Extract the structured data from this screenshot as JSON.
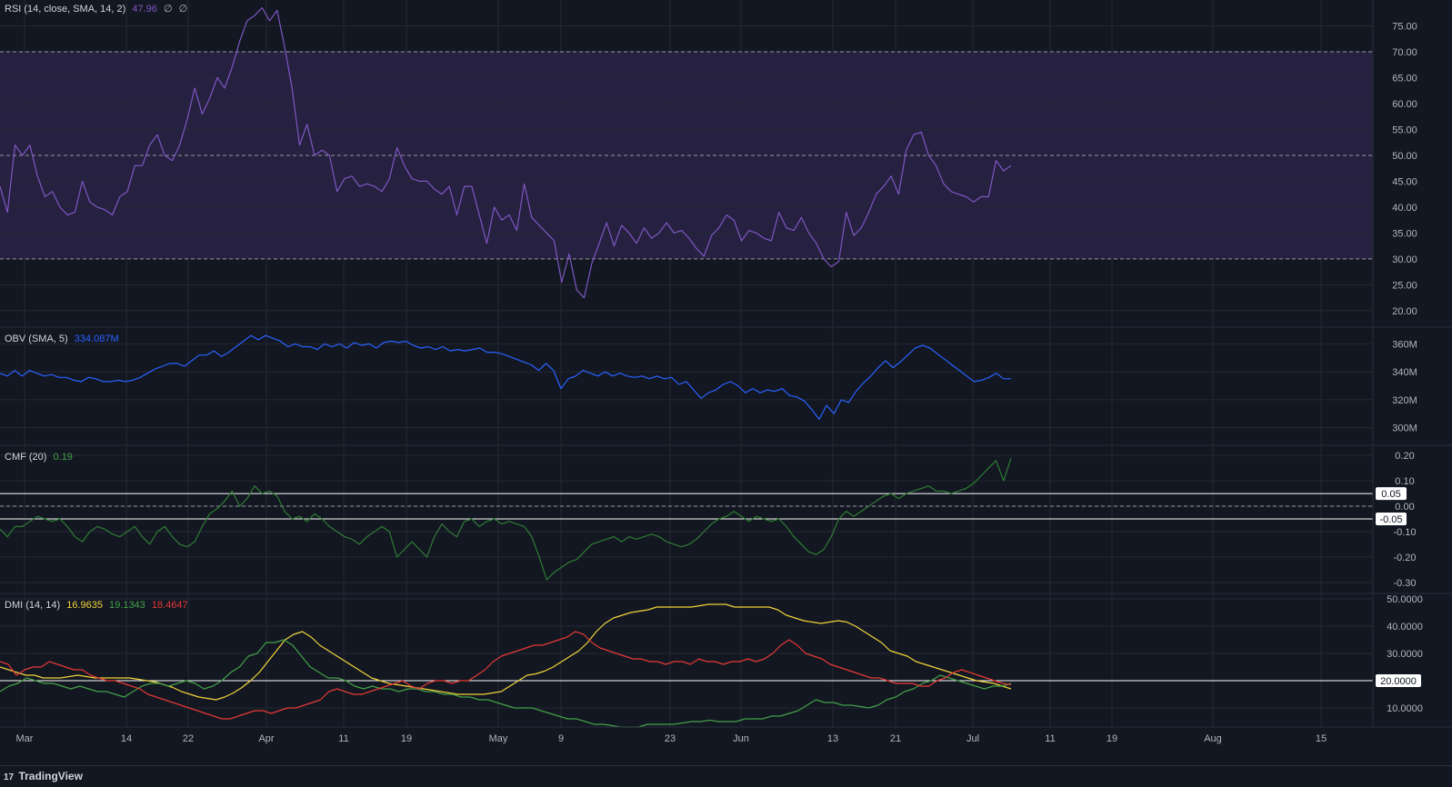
{
  "colors": {
    "background": "#131722",
    "grid": "#242833",
    "axis_text": "#b2b5be",
    "rsi": "#7e57c2",
    "rsi_band": "#2a2247",
    "obv": "#2962ff",
    "cmf": "#2e7d32",
    "dmi_adx": "#f0d43a",
    "dmi_plus": "#43a047",
    "dmi_minus": "#e53935",
    "ref_line": "#ffffff"
  },
  "legends": {
    "rsi": {
      "label": "RSI (14, close, SMA, 14, 2)",
      "value": "47.96",
      "extra1": "∅",
      "extra2": "∅"
    },
    "obv": {
      "label": "OBV (SMA, 5)",
      "value": "334.087M"
    },
    "cmf": {
      "label": "CMF (20)",
      "value": "0.19"
    },
    "dmi": {
      "label": "DMI (14, 14)",
      "adx": "16.9635",
      "plus": "19.1343",
      "minus": "18.4647"
    }
  },
  "x_axis": {
    "ticks": [
      "Mar",
      "14",
      "22",
      "Apr",
      "11",
      "19",
      "May",
      "9",
      "23",
      "Jun",
      "13",
      "21",
      "Jul",
      "11",
      "19",
      "Aug",
      "15"
    ]
  },
  "footer": {
    "brand": "TradingView",
    "logo_mark": "17"
  },
  "chart_data": [
    {
      "type": "line",
      "name": "RSI (14, close, SMA, 14, 2)",
      "ylim": [
        17,
        80
      ],
      "y_ticks": [
        "75.00",
        "70.00",
        "65.00",
        "60.00",
        "55.00",
        "50.00",
        "45.00",
        "40.00",
        "35.00",
        "30.00",
        "25.00",
        "20.00"
      ],
      "reference_lines": [
        70,
        50,
        30
      ],
      "band": [
        30,
        70
      ],
      "values": [
        44,
        39,
        52,
        50,
        52,
        46,
        42,
        43,
        40,
        38.5,
        39,
        45,
        41,
        40,
        39.5,
        38.5,
        42,
        43,
        48,
        48,
        52,
        54,
        50,
        49,
        52,
        57,
        63,
        58,
        61,
        65,
        63,
        67,
        72,
        76,
        77,
        78.5,
        76,
        78,
        71,
        63,
        52,
        56,
        50,
        51,
        50,
        43,
        45.5,
        46,
        44,
        44.5,
        44,
        43,
        45.5,
        51.5,
        48,
        45.5,
        45,
        45,
        43.5,
        42.5,
        44,
        38.5,
        44,
        44,
        38.5,
        33,
        40,
        37.5,
        38.5,
        35.5,
        44.5,
        38,
        36.5,
        35,
        33.5,
        25.5,
        31,
        24,
        22.5,
        29,
        33,
        37,
        32.5,
        36.5,
        35,
        33,
        36,
        34,
        35,
        37,
        35,
        35.5,
        34,
        32,
        30.5,
        34.5,
        36,
        38.5,
        37.5,
        33.5,
        35.5,
        35,
        34,
        33.5,
        39,
        36,
        35.5,
        38,
        35,
        33,
        30,
        28.5,
        29.5,
        39,
        34.5,
        36,
        39,
        42.5,
        44,
        46,
        42.5,
        51,
        54,
        54.5,
        50,
        48,
        44.5,
        43,
        42.5,
        42,
        41,
        42,
        42,
        49,
        47,
        48
      ]
    },
    {
      "type": "line",
      "name": "OBV (SMA, 5)",
      "ylim": [
        288,
        372
      ],
      "y_ticks": [
        "360M",
        "340M",
        "320M",
        "300M"
      ],
      "values": [
        339,
        337,
        341,
        337,
        341,
        339,
        337,
        338,
        336,
        336,
        334,
        333,
        336,
        335,
        333,
        333,
        334,
        333,
        334,
        336,
        339,
        342,
        344,
        346,
        346,
        344,
        348,
        352,
        352,
        355,
        351,
        354,
        358,
        362,
        366,
        363,
        366,
        364,
        362,
        358,
        360,
        358,
        358,
        356,
        360,
        358,
        360,
        357,
        361,
        359,
        360,
        357,
        361,
        362,
        361,
        362,
        359,
        357,
        358,
        356,
        358,
        355,
        356,
        355,
        356,
        357,
        354,
        354,
        353,
        351,
        349,
        347,
        345,
        341,
        346,
        341,
        328,
        335,
        337,
        341,
        339,
        337,
        340,
        337,
        339,
        337,
        336,
        337,
        335,
        337,
        335,
        336,
        331,
        333,
        327,
        321,
        325,
        327,
        331,
        333,
        330,
        325,
        328,
        325,
        327,
        326,
        328,
        323,
        322,
        319,
        313,
        306,
        316,
        310,
        320,
        318,
        326,
        332,
        337,
        343,
        348,
        343,
        347,
        352,
        357,
        359,
        357,
        353,
        349,
        345,
        341,
        337,
        333,
        334,
        336,
        339,
        335,
        335
      ]
    },
    {
      "type": "line",
      "name": "CMF (20)",
      "ylim": [
        -0.34,
        0.24
      ],
      "y_ticks": [
        "0.20",
        "0.10",
        "0.00",
        "-0.10",
        "-0.20",
        "-0.30"
      ],
      "labeled_lines": [
        {
          "value": 0.05,
          "label": "0.05"
        },
        {
          "value": -0.05,
          "label": "-0.05"
        }
      ],
      "dashed_line": 0,
      "values": [
        -0.09,
        -0.12,
        -0.08,
        -0.08,
        -0.06,
        -0.04,
        -0.05,
        -0.06,
        -0.05,
        -0.08,
        -0.12,
        -0.14,
        -0.1,
        -0.08,
        -0.09,
        -0.11,
        -0.12,
        -0.1,
        -0.08,
        -0.12,
        -0.15,
        -0.1,
        -0.08,
        -0.12,
        -0.15,
        -0.16,
        -0.14,
        -0.08,
        -0.03,
        -0.01,
        0.02,
        0.06,
        0.0,
        0.03,
        0.08,
        0.05,
        0.06,
        0.04,
        -0.02,
        -0.05,
        -0.04,
        -0.06,
        -0.03,
        -0.05,
        -0.08,
        -0.1,
        -0.12,
        -0.13,
        -0.15,
        -0.12,
        -0.1,
        -0.08,
        -0.1,
        -0.2,
        -0.17,
        -0.14,
        -0.17,
        -0.2,
        -0.12,
        -0.07,
        -0.1,
        -0.12,
        -0.06,
        -0.05,
        -0.08,
        -0.06,
        -0.05,
        -0.07,
        -0.06,
        -0.07,
        -0.08,
        -0.12,
        -0.2,
        -0.29,
        -0.26,
        -0.24,
        -0.22,
        -0.21,
        -0.18,
        -0.15,
        -0.14,
        -0.13,
        -0.12,
        -0.14,
        -0.12,
        -0.13,
        -0.12,
        -0.11,
        -0.12,
        -0.14,
        -0.15,
        -0.16,
        -0.15,
        -0.13,
        -0.1,
        -0.07,
        -0.05,
        -0.04,
        -0.02,
        -0.04,
        -0.06,
        -0.04,
        -0.05,
        -0.06,
        -0.05,
        -0.08,
        -0.12,
        -0.15,
        -0.18,
        -0.19,
        -0.17,
        -0.12,
        -0.05,
        -0.02,
        -0.04,
        -0.02,
        0.0,
        0.02,
        0.04,
        0.05,
        0.03,
        0.05,
        0.06,
        0.07,
        0.08,
        0.06,
        0.06,
        0.05,
        0.06,
        0.07,
        0.09,
        0.12,
        0.15,
        0.18,
        0.1,
        0.19
      ]
    },
    {
      "type": "line",
      "name": "DMI (14, 14)",
      "ylim": [
        3,
        52
      ],
      "y_ticks": [
        "50.0000",
        "40.0000",
        "30.0000",
        "10.0000"
      ],
      "labeled_lines": [
        {
          "value": 20,
          "label": "20.0000"
        }
      ],
      "x_ticks": [
        "Mar",
        "14",
        "22",
        "Apr",
        "11",
        "19",
        "May",
        "9",
        "23",
        "Jun",
        "13",
        "21",
        "Jul",
        "11",
        "19",
        "Aug",
        "15"
      ],
      "series": [
        {
          "name": "ADX",
          "values": [
            25,
            24,
            23,
            22,
            22,
            21,
            21,
            21,
            21.5,
            22,
            21.5,
            21,
            21,
            21,
            21,
            21,
            20.5,
            20,
            19.5,
            18.5,
            17.5,
            16,
            15,
            14,
            13.5,
            13,
            14,
            15.5,
            17.5,
            20,
            23,
            27,
            31,
            35,
            37,
            38,
            36,
            33,
            31,
            29,
            27,
            25,
            23,
            21,
            20,
            19,
            18.5,
            18,
            17.5,
            17,
            16.5,
            16,
            15.5,
            15,
            15,
            15,
            15,
            15.5,
            16,
            18,
            20,
            22,
            22.5,
            23.5,
            25,
            27,
            29,
            31,
            34,
            38,
            41,
            43,
            44,
            45,
            45.5,
            46,
            47,
            47,
            47,
            47,
            47,
            47.5,
            48,
            48,
            48,
            47,
            47,
            47,
            47,
            47,
            46,
            44,
            43,
            42,
            41.5,
            41,
            41.5,
            42,
            41.5,
            40,
            38,
            36,
            34,
            31,
            30,
            29,
            27,
            26,
            25,
            24,
            23,
            22,
            21,
            20,
            19.5,
            19,
            18,
            17
          ]
        },
        {
          "name": "+DI",
          "values": [
            16,
            18,
            19,
            21,
            20,
            19,
            19,
            18,
            17,
            18,
            17,
            16,
            16,
            15,
            14,
            16,
            18,
            19,
            19,
            18,
            19,
            20,
            19,
            17,
            18,
            20,
            23,
            25,
            29,
            30,
            34,
            34,
            35,
            33,
            29,
            25,
            23,
            21,
            21,
            20,
            18,
            17,
            18,
            17,
            17,
            16,
            17,
            17,
            16,
            16,
            15,
            15,
            14,
            14,
            13,
            13,
            12,
            11,
            10,
            10,
            10,
            9,
            8,
            7,
            6,
            6,
            5,
            4,
            4,
            3.5,
            3,
            3,
            3,
            4,
            4,
            4,
            4,
            4.5,
            5,
            5,
            5.5,
            5,
            5,
            5,
            6,
            6,
            6,
            7,
            7,
            8,
            9,
            11,
            13,
            12,
            12,
            11,
            11,
            10.5,
            10,
            11,
            13,
            14,
            16,
            17,
            19,
            20,
            22,
            21,
            20,
            19,
            18,
            17,
            18,
            18,
            19
          ]
        },
        {
          "name": "-DI",
          "values": [
            27,
            26,
            22,
            24,
            25,
            25,
            27,
            26,
            25,
            24,
            24,
            22,
            21,
            20,
            20,
            19,
            18,
            17,
            15,
            14,
            13,
            12,
            11,
            10,
            9,
            8,
            7,
            6,
            6,
            7,
            8,
            9,
            9,
            8,
            9,
            10,
            10,
            11,
            12,
            13,
            16,
            17,
            16,
            15,
            15,
            16,
            17,
            18,
            19,
            20,
            18,
            17,
            19,
            20,
            20,
            19,
            20,
            20,
            22,
            24,
            27,
            29,
            30,
            31,
            32,
            33,
            33,
            34,
            35,
            36,
            38,
            37,
            34,
            32,
            31,
            30,
            29,
            28,
            28,
            27,
            27,
            26,
            27,
            27,
            26,
            28,
            27,
            27,
            26,
            27,
            27,
            28,
            27,
            28,
            30,
            33,
            35,
            33,
            30,
            29,
            28,
            26,
            25,
            24,
            23,
            22,
            21,
            21,
            20,
            19,
            19,
            19,
            18,
            18,
            20,
            21,
            23,
            24,
            23,
            22,
            21,
            20,
            19,
            18.5
          ]
        }
      ]
    }
  ]
}
